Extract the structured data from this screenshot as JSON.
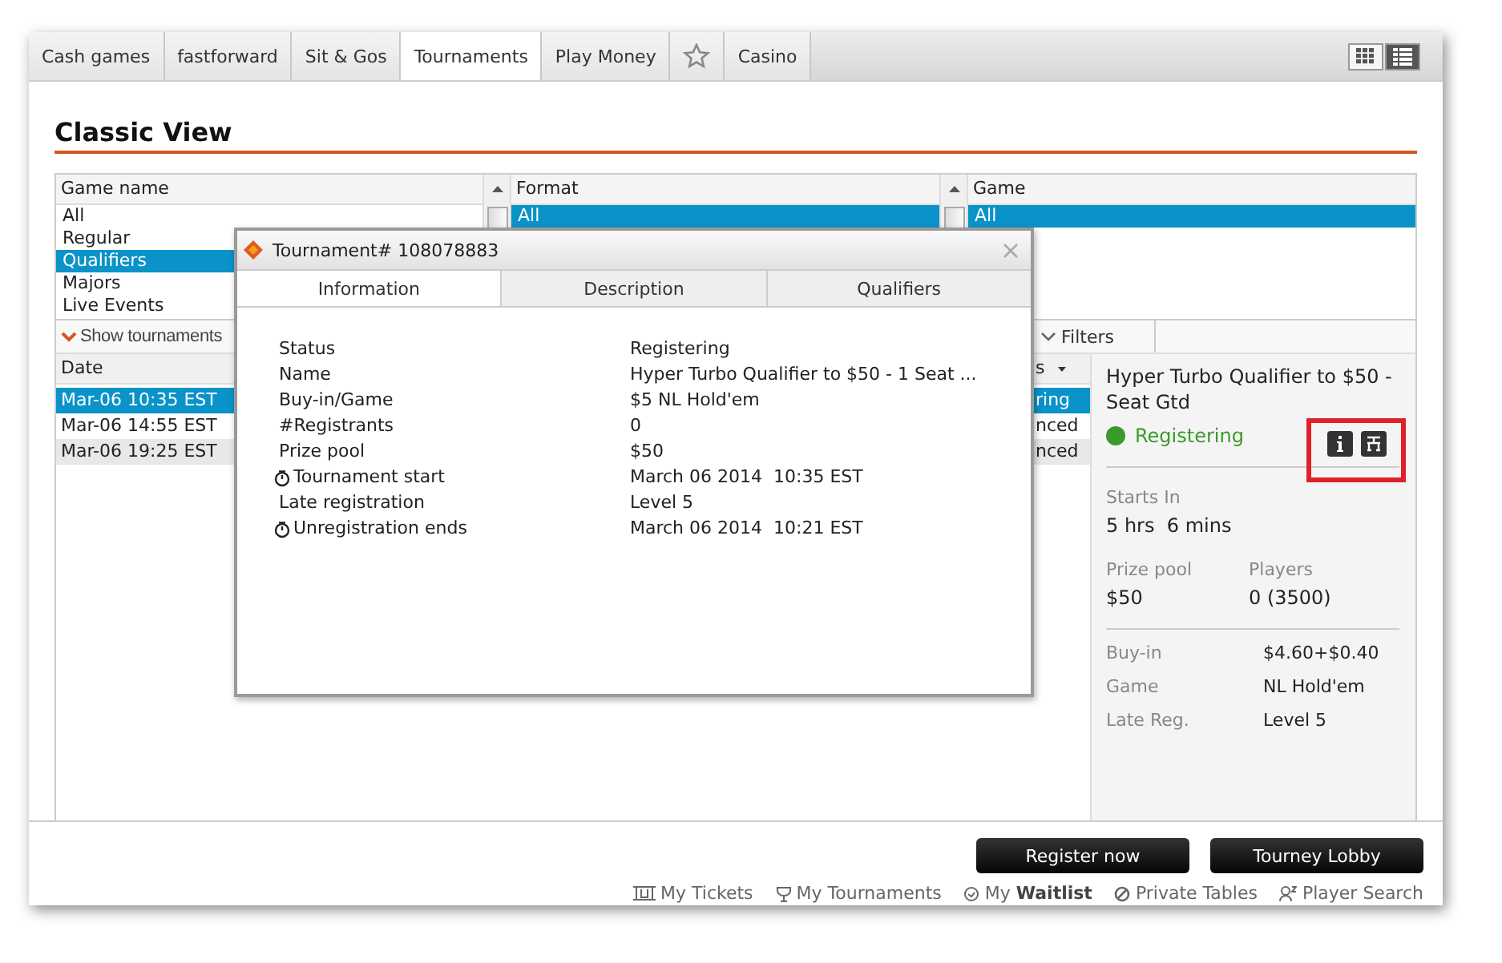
{
  "tabs": [
    {
      "kind": "text",
      "label": "Cash games",
      "selected": false
    },
    {
      "kind": "text",
      "label": "fastforward",
      "selected": false
    },
    {
      "kind": "text",
      "label": "Sit & Gos",
      "selected": false
    },
    {
      "kind": "text",
      "label": "Tournaments",
      "selected": true
    },
    {
      "kind": "text",
      "label": "Play Money",
      "selected": false
    },
    {
      "kind": "star",
      "selected": false
    },
    {
      "kind": "text",
      "label": "Casino",
      "selected": false
    }
  ],
  "view_toggle": [
    {
      "kind": "grid",
      "selected": false
    },
    {
      "kind": "list",
      "selected": true
    }
  ],
  "page_title": "Classic View",
  "filters": [
    {
      "header": "Game name",
      "items": [
        {
          "label": "All",
          "selected": false
        },
        {
          "label": "Regular",
          "selected": false
        },
        {
          "label": "Qualifiers",
          "selected": true
        },
        {
          "label": "Majors",
          "selected": false
        },
        {
          "label": "Live Events",
          "selected": false
        }
      ]
    },
    {
      "header": "Format",
      "items": [
        {
          "label": "All",
          "selected": true
        }
      ]
    },
    {
      "header": "Game",
      "items": [
        {
          "label": "All",
          "selected": true
        }
      ]
    }
  ],
  "show_tournaments": "Show tournaments",
  "filters_toggle": "Filters",
  "table": {
    "columns": [
      "Date",
      "s"
    ],
    "rows": [
      {
        "cells": [
          "Mar-06 10:35 EST",
          "ring"
        ],
        "selected": true
      },
      {
        "cells": [
          "Mar-06 14:55 EST",
          "nced"
        ],
        "selected": false
      },
      {
        "cells": [
          "Mar-06 19:25 EST",
          "nced"
        ],
        "selected": false
      }
    ]
  },
  "details": {
    "title": "Hyper Turbo Qualifier to $50 - Seat Gtd",
    "status": "Registering",
    "starts_in_label": "Starts In",
    "starts_in": "5 hrs  6 mins",
    "stats": [
      {
        "label": "Prize pool",
        "value": "$50"
      },
      {
        "label": "Players",
        "value": "0 (3500)"
      }
    ],
    "facts": [
      {
        "label": "Buy-in",
        "value": "$4.60+$0.40"
      },
      {
        "label": "Game",
        "value": "NL Hold'em"
      },
      {
        "label": "Late Reg.",
        "value": "Level 5"
      }
    ]
  },
  "buttons": [
    "Register now",
    "Tourney Lobby"
  ],
  "footer_links": [
    {
      "kind": "tickets",
      "label": "My Tickets"
    },
    {
      "kind": "trophy",
      "label": "My Tournaments"
    },
    {
      "kind": "waitlist",
      "label": "My **Waitlist**"
    },
    {
      "kind": "private",
      "label": "Private Tables"
    },
    {
      "kind": "player",
      "label": "Player Search"
    }
  ],
  "dialog": {
    "title": "Tournament# 108078883",
    "tabs": [
      {
        "label": "Information",
        "selected": true
      },
      {
        "label": "Description",
        "selected": false
      },
      {
        "label": "Qualifiers",
        "selected": false
      }
    ],
    "rows": [
      {
        "kind": "plain",
        "label": "Status",
        "value": "Registering"
      },
      {
        "kind": "plain",
        "label": "Name",
        "value": "Hyper Turbo Qualifier to $50 - 1 Seat ..."
      },
      {
        "kind": "plain",
        "label": "Buy-in/Game",
        "value": "$5 NL Hold'em"
      },
      {
        "kind": "plain",
        "label": "#Registrants",
        "value": "0"
      },
      {
        "kind": "plain",
        "label": "Prize pool",
        "value": "$50"
      },
      {
        "kind": "time",
        "label": "Tournament start",
        "value": "March 06 2014  10:35 EST"
      },
      {
        "kind": "plain",
        "label": "Late registration",
        "value": "Level 5"
      },
      {
        "kind": "time",
        "label": "Unregistration ends",
        "value": "March 06 2014  10:21 EST"
      }
    ]
  }
}
